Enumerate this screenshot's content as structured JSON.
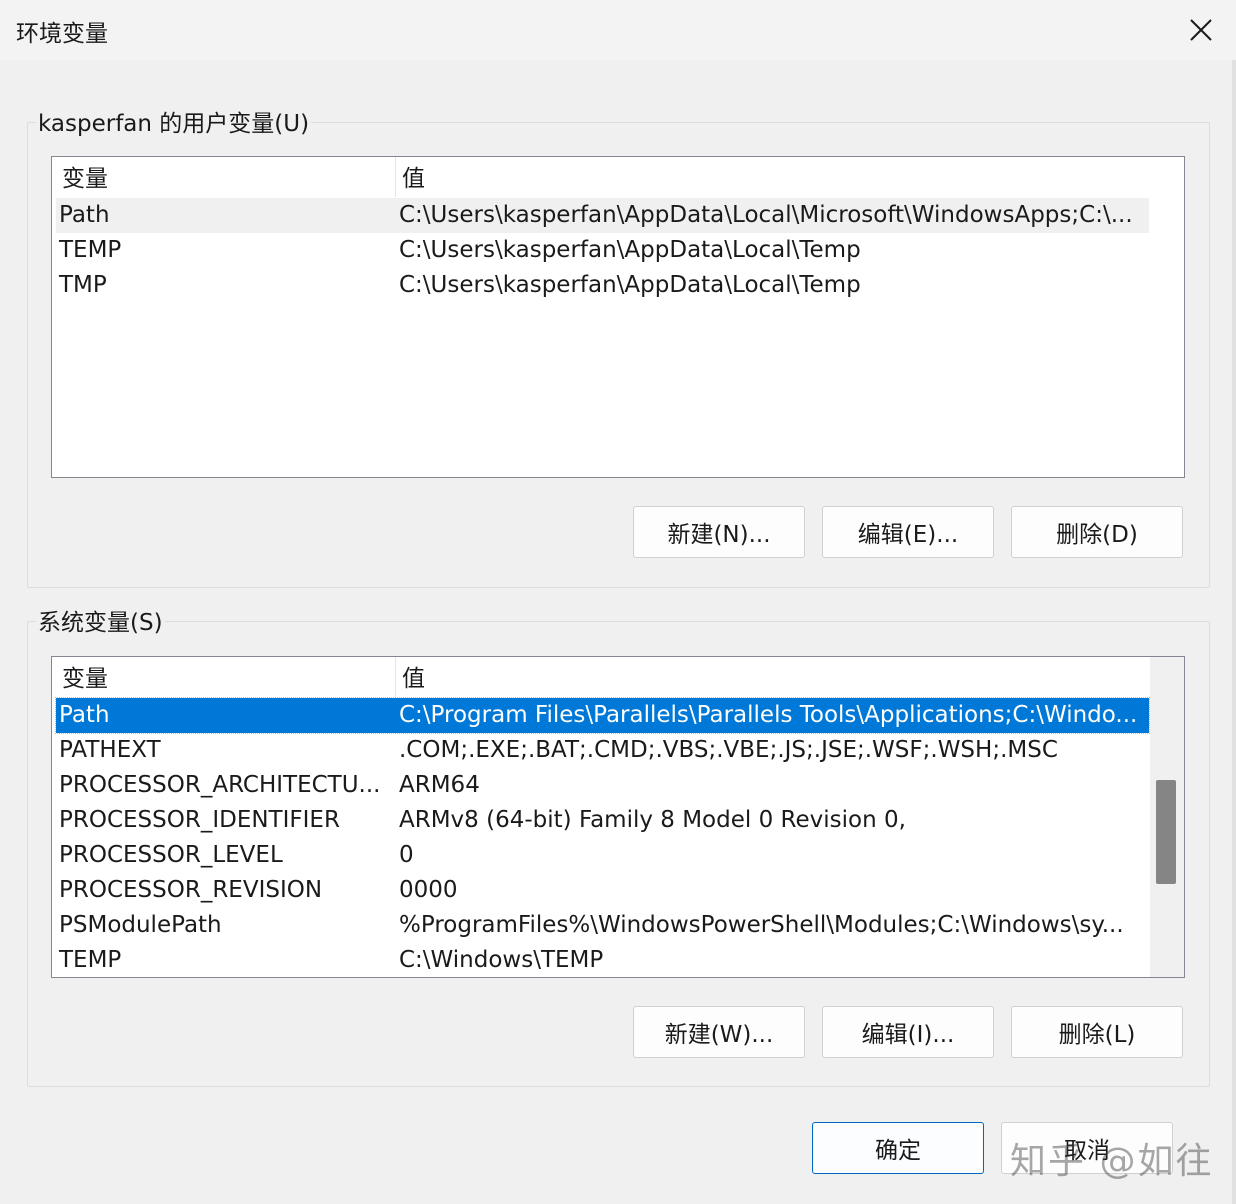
{
  "window": {
    "title": "环境变量",
    "close_icon": "close-icon"
  },
  "user_vars": {
    "group_label": "kasperfan 的用户变量(U)",
    "columns": [
      "变量",
      "值"
    ],
    "rows": [
      {
        "name": "Path",
        "value": "C:\\Users\\kasperfan\\AppData\\Local\\Microsoft\\WindowsApps;C:\\..."
      },
      {
        "name": "TEMP",
        "value": "C:\\Users\\kasperfan\\AppData\\Local\\Temp"
      },
      {
        "name": "TMP",
        "value": "C:\\Users\\kasperfan\\AppData\\Local\\Temp"
      }
    ],
    "buttons": {
      "new": "新建(N)...",
      "edit": "编辑(E)...",
      "delete": "删除(D)"
    }
  },
  "system_vars": {
    "group_label": "系统变量(S)",
    "columns": [
      "变量",
      "值"
    ],
    "rows": [
      {
        "name": "Path",
        "value": "C:\\Program Files\\Parallels\\Parallels Tools\\Applications;C:\\Windo..."
      },
      {
        "name": "PATHEXT",
        "value": ".COM;.EXE;.BAT;.CMD;.VBS;.VBE;.JS;.JSE;.WSF;.WSH;.MSC"
      },
      {
        "name": "PROCESSOR_ARCHITECTU...",
        "value": "ARM64"
      },
      {
        "name": "PROCESSOR_IDENTIFIER",
        "value": "ARMv8 (64-bit) Family 8 Model 0 Revision   0,"
      },
      {
        "name": "PROCESSOR_LEVEL",
        "value": "0"
      },
      {
        "name": "PROCESSOR_REVISION",
        "value": "0000"
      },
      {
        "name": "PSModulePath",
        "value": "%ProgramFiles%\\WindowsPowerShell\\Modules;C:\\Windows\\sy..."
      },
      {
        "name": "TEMP",
        "value": "C:\\Windows\\TEMP"
      }
    ],
    "buttons": {
      "new": "新建(W)...",
      "edit": "编辑(I)...",
      "delete": "删除(L)"
    }
  },
  "footer": {
    "ok": "确定",
    "cancel": "取消"
  },
  "watermark": "知乎 @如往",
  "colors": {
    "selection": "#0078d7",
    "background": "#f0f0f0",
    "primary_border": "#0067c0"
  }
}
